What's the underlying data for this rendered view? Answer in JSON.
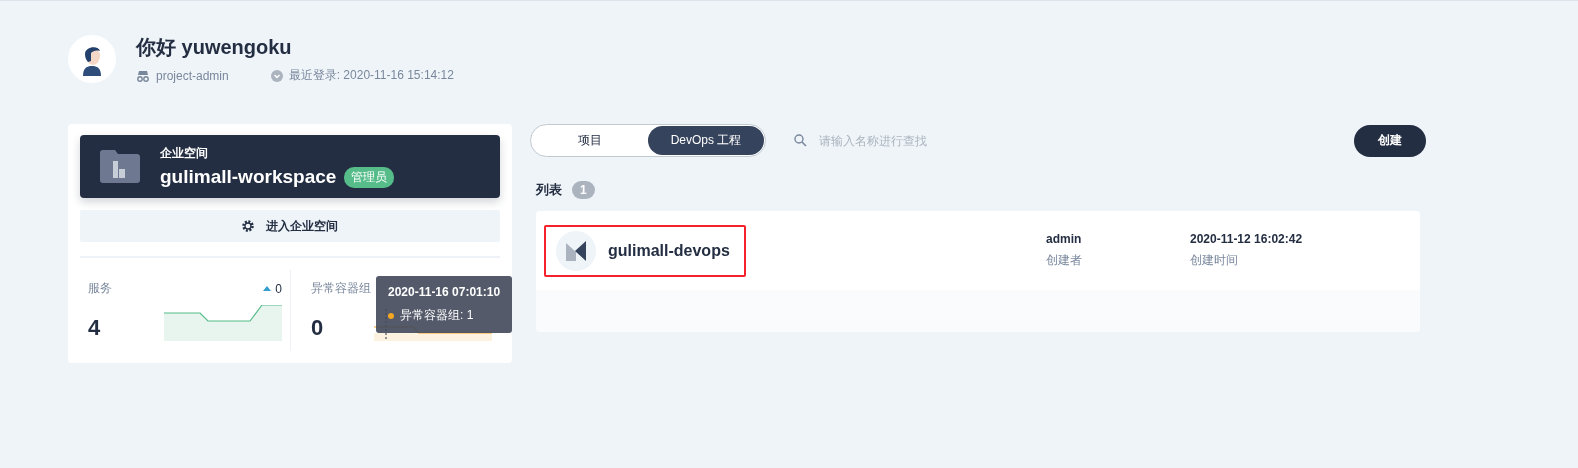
{
  "user": {
    "greeting": "你好 yuwengoku",
    "role": "project-admin",
    "last_login": "最近登录: 2020-11-16 15:14:12"
  },
  "workspace": {
    "label": "企业空间",
    "name": "gulimall-workspace",
    "badge": "管理员",
    "enter_button": "进入企业空间",
    "stats": [
      {
        "label": "服务",
        "value": "4",
        "trend": "0"
      },
      {
        "label": "异常容器组",
        "value": "0"
      }
    ],
    "tooltip": {
      "time": "2020-11-16 07:01:10",
      "entry": "异常容器组: 1"
    }
  },
  "tabs": [
    {
      "label": "项目",
      "selected": false
    },
    {
      "label": "DevOps 工程",
      "selected": true
    }
  ],
  "search": {
    "placeholder": "请输入名称进行查找"
  },
  "create_button": "创建",
  "list": {
    "title": "列表",
    "count": "1",
    "items": [
      {
        "name": "gulimall-devops",
        "highlighted": true,
        "creator": "admin",
        "creator_label": "创建者",
        "created": "2020-11-12 16:02:42",
        "created_label": "创建时间"
      }
    ]
  }
}
